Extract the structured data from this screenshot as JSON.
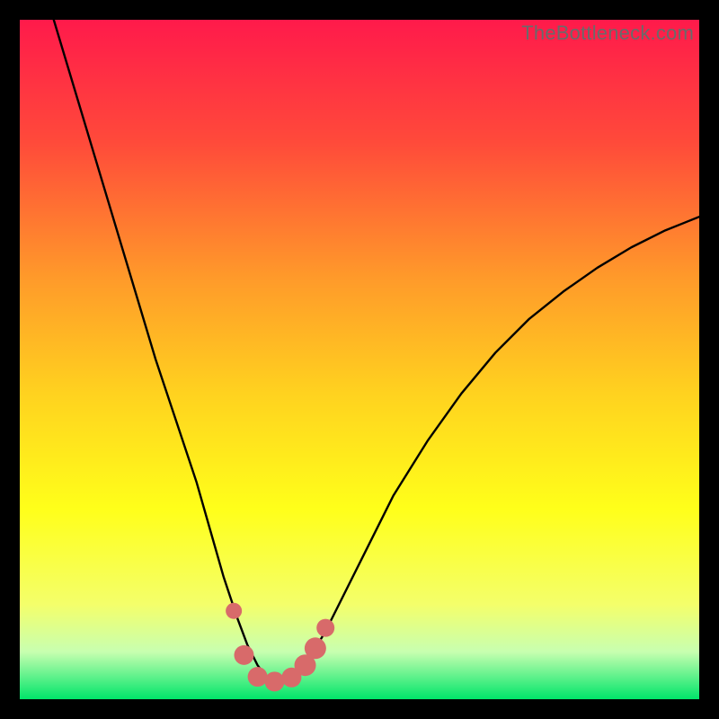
{
  "watermark": "TheBottleneck.com",
  "chart_data": {
    "type": "line",
    "title": "",
    "xlabel": "",
    "ylabel": "",
    "xlim": [
      0,
      100
    ],
    "ylim": [
      0,
      100
    ],
    "grid": false,
    "legend": false,
    "background_gradient": {
      "stops": [
        {
          "offset": 0.0,
          "color": "#ff1a4b"
        },
        {
          "offset": 0.18,
          "color": "#ff4a3a"
        },
        {
          "offset": 0.38,
          "color": "#ff9a2a"
        },
        {
          "offset": 0.55,
          "color": "#ffd21f"
        },
        {
          "offset": 0.72,
          "color": "#ffff1a"
        },
        {
          "offset": 0.86,
          "color": "#f4ff6a"
        },
        {
          "offset": 0.93,
          "color": "#c8ffb0"
        },
        {
          "offset": 1.0,
          "color": "#00e56a"
        }
      ]
    },
    "series": [
      {
        "name": "bottleneck-curve",
        "stroke": "#000000",
        "stroke_width": 2.4,
        "x": [
          5,
          8,
          11,
          14,
          17,
          20,
          23,
          26,
          28,
          30,
          32,
          33.5,
          35,
          36.5,
          38,
          40,
          42,
          45,
          50,
          55,
          60,
          65,
          70,
          75,
          80,
          85,
          90,
          95,
          100
        ],
        "y": [
          100,
          90,
          80,
          70,
          60,
          50,
          41,
          32,
          25,
          18,
          12,
          8,
          5,
          3,
          2.5,
          3,
          5,
          10,
          20,
          30,
          38,
          45,
          51,
          56,
          60,
          63.5,
          66.5,
          69,
          71
        ]
      }
    ],
    "markers": {
      "name": "highlighted-points",
      "fill": "#d86a6a",
      "points": [
        {
          "x": 31.5,
          "y": 13.0,
          "r": 9
        },
        {
          "x": 33.0,
          "y": 6.5,
          "r": 11
        },
        {
          "x": 35.0,
          "y": 3.3,
          "r": 11
        },
        {
          "x": 37.5,
          "y": 2.6,
          "r": 11
        },
        {
          "x": 40.0,
          "y": 3.2,
          "r": 11
        },
        {
          "x": 42.0,
          "y": 5.0,
          "r": 12
        },
        {
          "x": 43.5,
          "y": 7.5,
          "r": 12
        },
        {
          "x": 45.0,
          "y": 10.5,
          "r": 10
        }
      ]
    }
  }
}
